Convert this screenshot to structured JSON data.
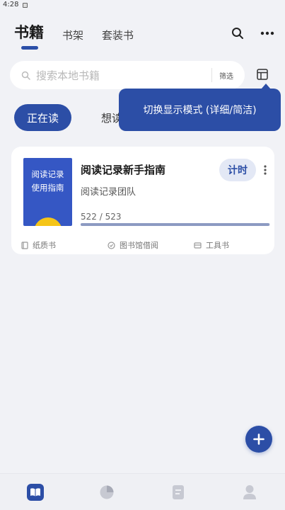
{
  "status_bar": {
    "time": "4:28"
  },
  "header": {
    "tabs": [
      {
        "label": "书籍",
        "active": true
      },
      {
        "label": "书架",
        "active": false
      },
      {
        "label": "套装书",
        "active": false
      }
    ],
    "icons": [
      "search-icon",
      "more-horizontal-icon"
    ]
  },
  "search": {
    "placeholder": "搜索本地书籍",
    "filter_label": "筛选"
  },
  "tooltip": {
    "text": "切换显示模式 (详细/简洁)"
  },
  "filter_tabs": [
    {
      "label": "正在读",
      "active": true
    },
    {
      "label": "想读",
      "active": false
    }
  ],
  "book": {
    "cover_text_line1": "阅读记录",
    "cover_text_line2": "使用指南",
    "title": "阅读记录新手指南",
    "author": "阅读记录团队",
    "timer_label": "计时",
    "progress_text": "522 / 523",
    "progress_fraction": 0.998,
    "tags": [
      "纸质书",
      "图书馆借阅",
      "工具书"
    ]
  },
  "colors": {
    "accent": "#2c4ea6",
    "background": "#f1f2f6",
    "card": "#ffffff"
  },
  "bottom_nav": {
    "items": [
      "book-open-icon",
      "pie-chart-icon",
      "note-icon",
      "user-icon"
    ],
    "active_index": 0
  }
}
